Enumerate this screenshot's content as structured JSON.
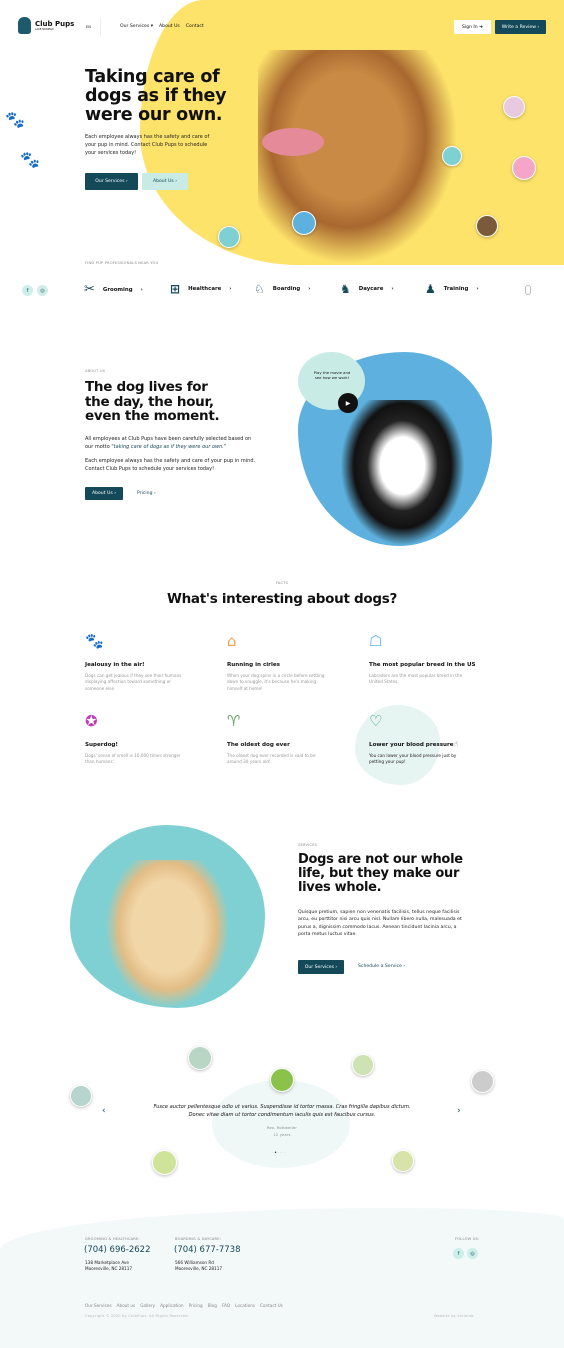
{
  "colors": {
    "accent": "#14495a",
    "yellow": "#fde36a",
    "blue": "#5eb1de",
    "teal": "#7fd0d2",
    "mint": "#c9ebe6"
  },
  "nav": {
    "brand": "Club Pups",
    "brand_sub": "LAKE NORMAN",
    "lang": "EN",
    "items": [
      "Our Services",
      "About Us",
      "Contact"
    ],
    "sign_in": "Sign In",
    "write_review": "Write a Review"
  },
  "hero": {
    "title": "Taking care of dogs as if they were our own.",
    "text": "Each employee always has the safety and care of your pup in mind. Contact Club Pups to schedule your services today!",
    "btn_services": "Our Services",
    "btn_about": "About Us"
  },
  "services_bar": {
    "label": "FIND PUP PROFESSIONALS NEAR YOU",
    "items": [
      {
        "label": "Grooming",
        "icon": "scissors-icon"
      },
      {
        "label": "Healthcare",
        "icon": "medical-kit-icon"
      },
      {
        "label": "Boarding",
        "icon": "dog-bed-icon"
      },
      {
        "label": "Daycare",
        "icon": "dog-leash-icon"
      },
      {
        "label": "Training",
        "icon": "dog-training-icon"
      }
    ]
  },
  "about": {
    "label": "ABOUT US",
    "title": "The dog lives for the day, the hour, even the moment.",
    "text1": "All employees at Club Pups have been carefully selected based on our motto ",
    "motto": "\"taking care of dogs as if they were our own.\"",
    "text2": "Each employee always has the safety and care of your pup in mind. Contact Club Pups to schedule your services today!",
    "btn_about": "About Us",
    "btn_pricing": "Pricing",
    "video_text": "Play the movie and see how we work!"
  },
  "facts": {
    "label": "FACTS",
    "title": "What's interesting about dogs?",
    "items": [
      {
        "title": "Jealousy in the air!",
        "text": "Dogs can get jealous if they see their humans displaying affection toward something or someone else",
        "icon": "paw-icon",
        "color": "#2b6f86"
      },
      {
        "title": "Running in cirles",
        "text": "When your dog spins in a circle before settling down to snuggle, it's because he's making himself at home!",
        "icon": "dog-house-icon",
        "color": "#f0a050"
      },
      {
        "title": "The most popular breed in the US",
        "text": "Labradors are the most popular breed in the United States.",
        "icon": "dog-face-icon",
        "color": "#5eb1de"
      },
      {
        "title": "Superdog!",
        "text": "Dogs' sense of smell is 10,000 times stronger than humans'.",
        "icon": "award-icon",
        "color": "#c03cb8"
      },
      {
        "title": "The oldest dog ever",
        "text": "The oldest dog ever recorded is said to be around 30 years old!",
        "icon": "trophy-icon",
        "color": "#6ea36a"
      },
      {
        "title": "Lower your blood pressure",
        "text": "You can lower your blood pressure just by petting your pup!",
        "icon": "heart-tag-icon",
        "color": "#3c9a8a"
      }
    ]
  },
  "services": {
    "label": "SERVICES",
    "title": "Dogs are not our whole life, but they make our lives whole.",
    "text": "Quisque pretium, sapien non venenatis facilisis, tellus neque facilisis arcu, eu porttitor nisi arcu quis nisl. Nullam libero nulla, malesuada et purus a, dignissim commodo lacus. Aenean tincidunt lacinia arcu, a porta metus luctus vitae.",
    "btn_services": "Our Services",
    "btn_schedule": "Schedule a Service"
  },
  "testimonial": {
    "quote": "Fusce auctor pellentesque odio ut varius. Suspendisse id tortor massa. Cras fringilla dapibus dictum. Donec vitae diam ut tortor condimentum iaculis quis est faucibus cursus.",
    "name": "Rex, Rottweiler",
    "age": "12 years"
  },
  "footer": {
    "col1_label": "GROOMING & HEALTHCARE:",
    "col1_phone": "(704) 696-2622",
    "col1_addr1": "138 Marketplace Ave",
    "col1_addr2": "Mooresville, NC 28117",
    "col2_label": "BOARDING & DAYCARE:",
    "col2_phone": "(704) 677-7738",
    "col2_addr1": "566 Williamson Rd",
    "col2_addr2": "Mooresville, NC 28117",
    "follow": "FOLLOW US:",
    "links": [
      "Our Services",
      "About us",
      "Gallery",
      "Application",
      "Pricing",
      "Blog",
      "FAQ",
      "Locations",
      "Contact Us"
    ],
    "copyright": "Copyright © 2020 by ClubPups. All Rights Reserved",
    "credit": "Website by Seriolab"
  }
}
